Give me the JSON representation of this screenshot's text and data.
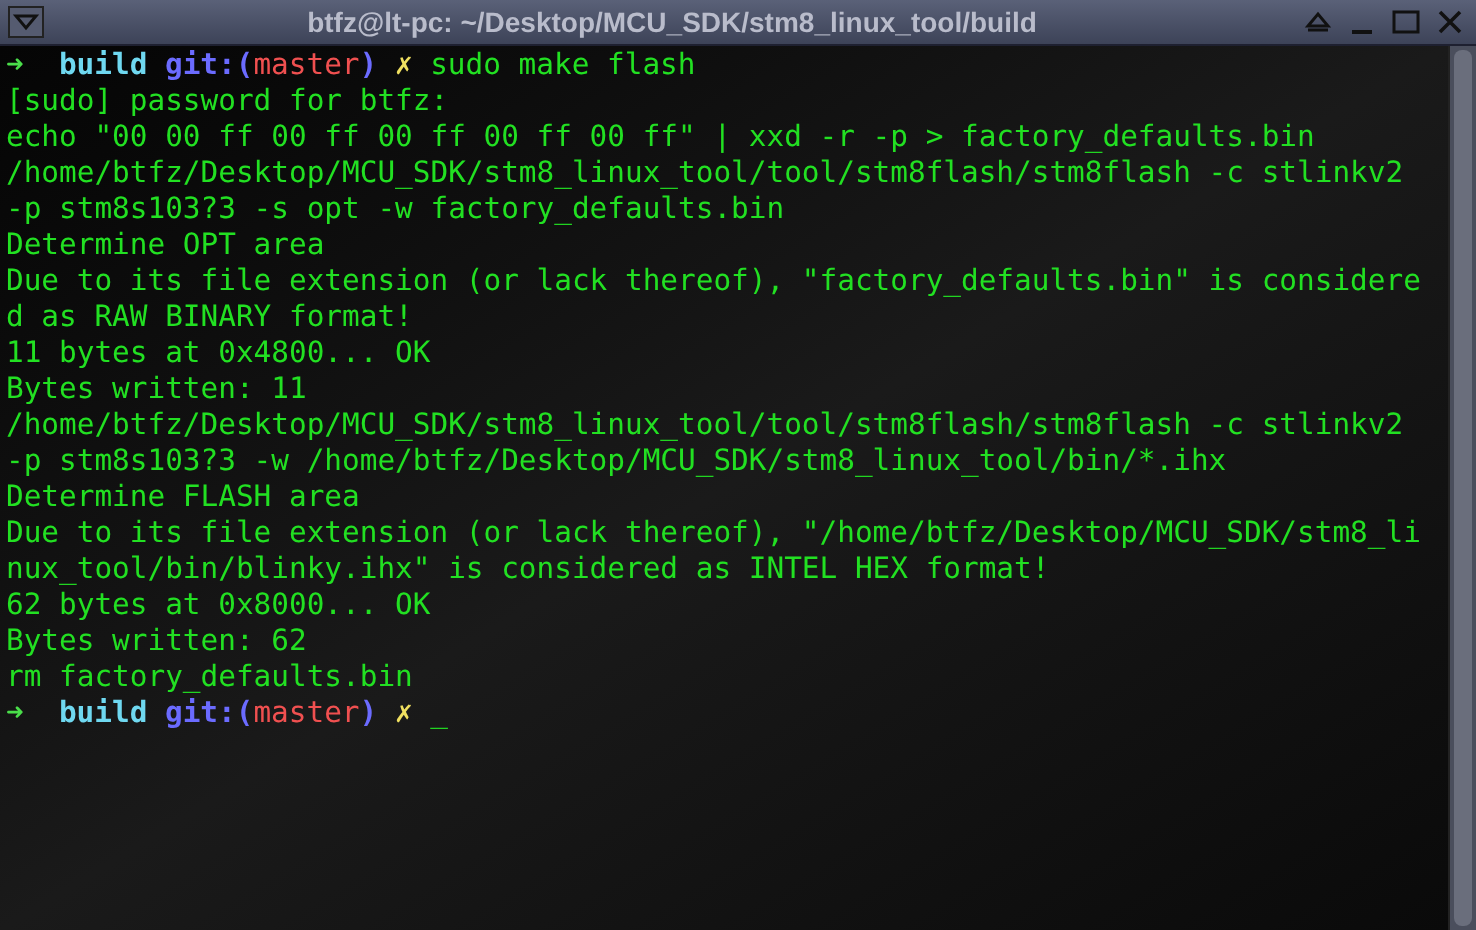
{
  "window": {
    "title": "btfz@lt-pc: ~/Desktop/MCU_SDK/stm8_linux_tool/build"
  },
  "lines": [
    {
      "kind": "prompt",
      "arrow": "➜",
      "dir": "build",
      "git": "git:(",
      "branch": "master",
      "git_close": ")",
      "dirty": "✗",
      "command": "sudo make flash"
    },
    {
      "kind": "output",
      "text": "[sudo] password for btfz:"
    },
    {
      "kind": "output",
      "text": "echo \"00 00 ff 00 ff 00 ff 00 ff 00 ff\" | xxd -r -p > factory_defaults.bin"
    },
    {
      "kind": "output",
      "text": "/home/btfz/Desktop/MCU_SDK/stm8_linux_tool/tool/stm8flash/stm8flash -c stlinkv2"
    },
    {
      "kind": "output",
      "text": "-p stm8s103?3 -s opt -w factory_defaults.bin"
    },
    {
      "kind": "output",
      "text": "Determine OPT area"
    },
    {
      "kind": "output",
      "text": "Due to its file extension (or lack thereof), \"factory_defaults.bin\" is considere"
    },
    {
      "kind": "output",
      "text": "d as RAW BINARY format!"
    },
    {
      "kind": "output",
      "text": "11 bytes at 0x4800... OK"
    },
    {
      "kind": "output",
      "text": "Bytes written: 11"
    },
    {
      "kind": "output",
      "text": "/home/btfz/Desktop/MCU_SDK/stm8_linux_tool/tool/stm8flash/stm8flash -c stlinkv2"
    },
    {
      "kind": "output",
      "text": "-p stm8s103?3 -w /home/btfz/Desktop/MCU_SDK/stm8_linux_tool/bin/*.ihx"
    },
    {
      "kind": "output",
      "text": "Determine FLASH area"
    },
    {
      "kind": "output",
      "text": "Due to its file extension (or lack thereof), \"/home/btfz/Desktop/MCU_SDK/stm8_li"
    },
    {
      "kind": "output",
      "text": "nux_tool/bin/blinky.ihx\" is considered as INTEL HEX format!"
    },
    {
      "kind": "output",
      "text": "62 bytes at 0x8000... OK"
    },
    {
      "kind": "output",
      "text": "Bytes written: 62"
    },
    {
      "kind": "output",
      "text": "rm factory_defaults.bin"
    },
    {
      "kind": "prompt",
      "arrow": "➜",
      "dir": "build",
      "git": "git:(",
      "branch": "master",
      "git_close": ")",
      "dirty": "✗",
      "cursor": "_"
    }
  ]
}
